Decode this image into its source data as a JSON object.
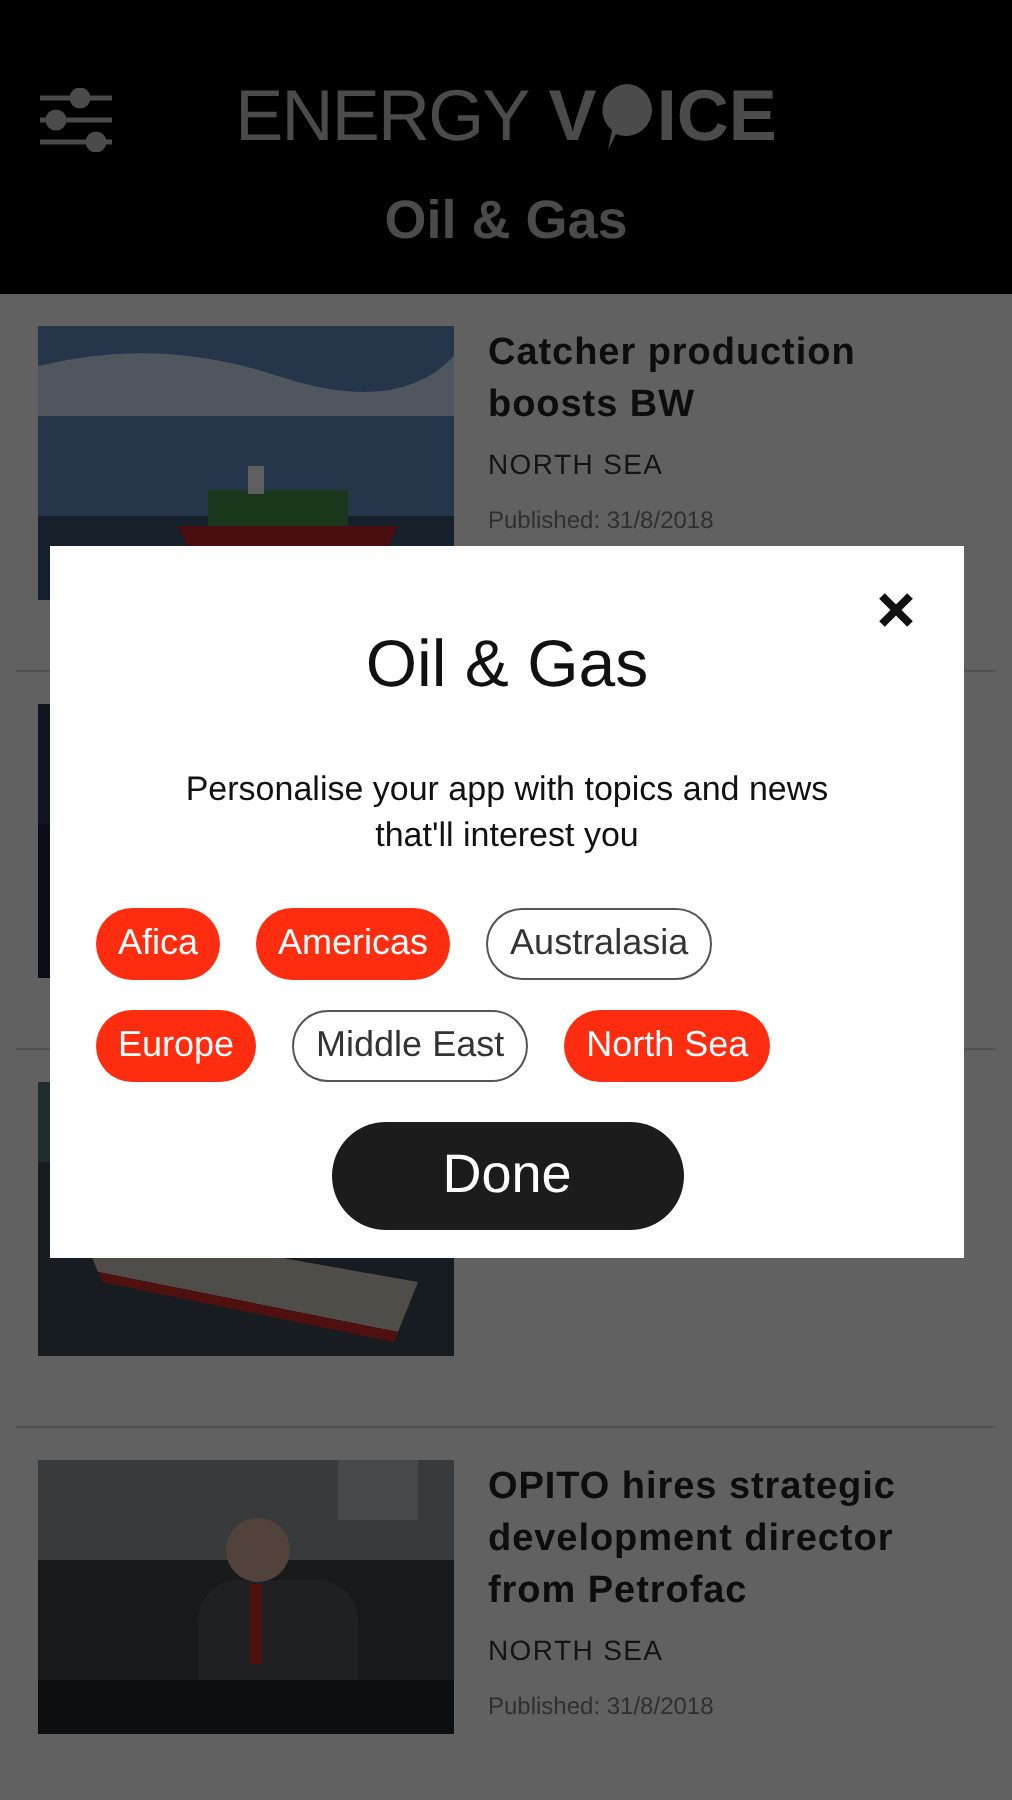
{
  "header": {
    "logo": {
      "light": "ENERGY",
      "bold_before": "V",
      "bold_after": "ICE"
    },
    "title": "Oil & Gas"
  },
  "articles": [
    {
      "kind": "full",
      "title": "Catcher production boosts BW",
      "region": "NORTH SEA",
      "published": "Published: 31/8/2018"
    },
    {
      "kind": "hidden"
    },
    {
      "kind": "hidden"
    },
    {
      "kind": "full",
      "title": "OPITO hires strategic development director from Petrofac",
      "region": "NORTH SEA",
      "published": "Published: 31/8/2018"
    }
  ],
  "dialog": {
    "title": "Oil & Gas",
    "description": "Personalise your app with topics and news that'll interest you",
    "topics": [
      {
        "label": "Afica",
        "selected": true
      },
      {
        "label": "Americas",
        "selected": true
      },
      {
        "label": "Australasia",
        "selected": false
      },
      {
        "label": "Europe",
        "selected": true
      },
      {
        "label": "Middle East",
        "selected": false
      },
      {
        "label": "North Sea",
        "selected": true
      }
    ],
    "button": "Done"
  }
}
